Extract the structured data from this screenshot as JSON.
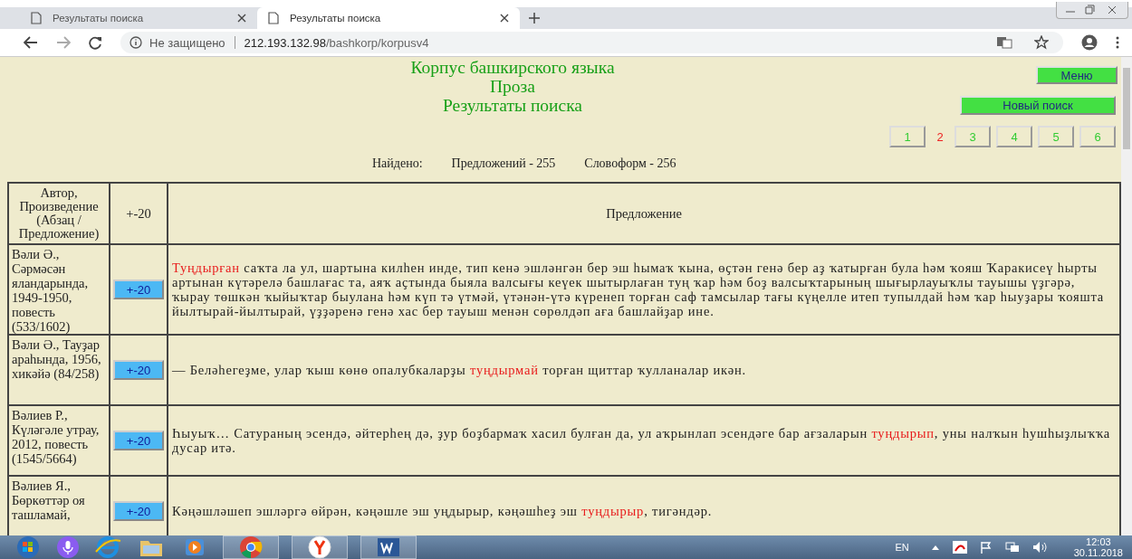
{
  "browser": {
    "tabs": [
      {
        "title": "Результаты поиска",
        "selected": false
      },
      {
        "title": "Результаты поиска",
        "selected": true
      }
    ],
    "security": "Не защищено",
    "url_host": "212.193.132.98",
    "url_path": "/bashkorp/korpusv4"
  },
  "header": {
    "title": "Корпус башкирского языка",
    "subtitle": "Проза",
    "heading": "Результаты поиска"
  },
  "buttons": {
    "menu": "Меню",
    "new_search": "Новый поиск"
  },
  "pages": [
    {
      "label": "1",
      "selected": false
    },
    {
      "label": "2",
      "selected": true
    },
    {
      "label": "3",
      "selected": false
    },
    {
      "label": "4",
      "selected": false
    },
    {
      "label": "5",
      "selected": false
    },
    {
      "label": "6",
      "selected": false
    }
  ],
  "found": {
    "label": "Найдено:",
    "sentences": "Предложений - 255",
    "wordforms": "Словоформ - 256"
  },
  "table": {
    "columns": [
      "Автор, Произведение (Абзац / Предложение)",
      "+-20",
      "Предложение"
    ],
    "rows": [
      {
        "source": "Вәли Ә., Сәрмәсән яландарында, 1949-1950, повесть (533/1602)",
        "context": "+-20",
        "sentence": [
          {
            "text": "Туңдырған",
            "highlight": true
          },
          {
            "text": " саҡта ла ул, шартына килһен инде, тип кенә эшләнгән бер эш һымаҡ ҡына, өҫтән генә бер аҙ ҡатырған була һәм ҡояш Ҡаракисеү һырты артынан күтәрелә башлағас та, аяҡ аҫтында быяла валсығы кеүек шытырлаған туң ҡар һәм боҙ валсыҡтарының шығырлауыҡлы тауышы үҙгәрә, ҡырау төшкән ҡыйыҡтар быулана һәм күп тә үтмәй, үтәнән-үтә күренеп торған саф тамсылар тағы күңелле итеп тупылдай һәм ҡар һыуҙары ҡояшта йылтырай-йылтырай, үҙҙәренә генә хас бер тауыш менән сөрөлдәп аға башлайҙар ине.",
            "highlight": false
          }
        ]
      },
      {
        "source": "Вәли Ә., Тауҙар араһында, 1956, хикәйә (84/258)",
        "context": "+-20",
        "sentence": [
          {
            "text": "— Беләһегеҙме, улар ҡыш көнө опалубкаларҙы ",
            "highlight": false
          },
          {
            "text": "туңдырмай",
            "highlight": true
          },
          {
            "text": " торған щиттар ҡулланалар икән.",
            "highlight": false
          }
        ]
      },
      {
        "source": "Вәлиев Р., Күләгәле утрау, 2012, повесть (1545/5664)",
        "context": "+-20",
        "sentence": [
          {
            "text": "Һыуыҡ… Сатураның эсендә, әйтерһең дә, ҙур боҙбармаҡ хасил булған да, ул аҡрынлап эсендәге бар ағзаларын ",
            "highlight": false
          },
          {
            "text": "туңдырып",
            "highlight": true
          },
          {
            "text": ", уны налҡын һушһыҙлыҡҡа дусар итә.",
            "highlight": false
          }
        ]
      },
      {
        "source": "Вәлиев Я., Бөркөттәр оя ташламай,",
        "context": "+-20",
        "sentence": [
          {
            "text": "Кәңәшләшеп эшләргә өйрән, кәңәшле эш уңдырыр, кәңәшһеҙ эш ",
            "highlight": false
          },
          {
            "text": "туңдырыр",
            "highlight": true
          },
          {
            "text": ", тигәндәр.",
            "highlight": false
          }
        ]
      }
    ]
  },
  "taskbar": {
    "language": "EN",
    "time": "12:03",
    "date": "30.11.2018"
  }
}
